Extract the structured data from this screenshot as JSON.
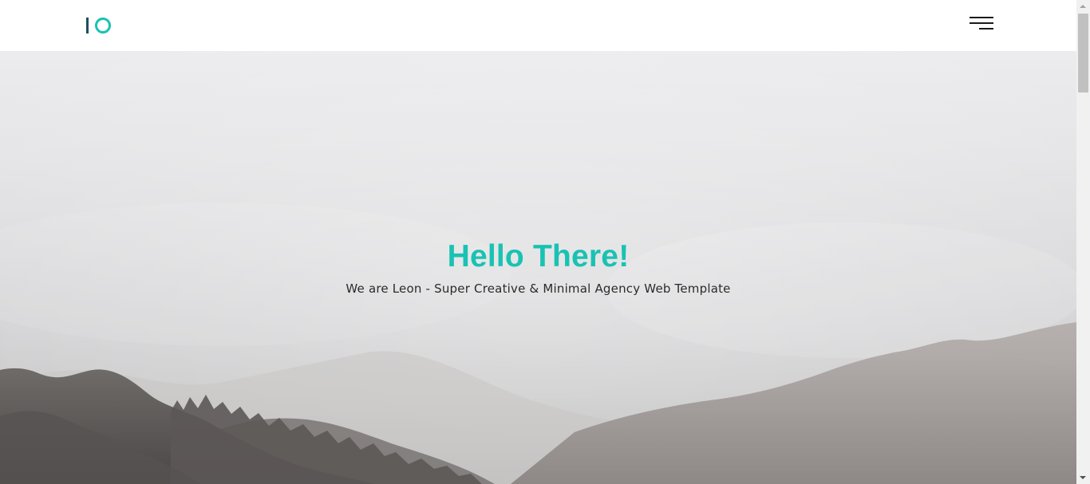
{
  "header": {
    "logo": {
      "icon": "io-logo-icon",
      "bar_color": "#1e4f5f",
      "ring_color": "#19c2b3"
    },
    "menu": {
      "icon": "hamburger-menu-icon"
    }
  },
  "hero": {
    "title": "Hello There!",
    "subtitle": "We are Leon - Super Creative & Minimal Agency Web Template",
    "background": "misty mountain landscape",
    "accent_color": "#19c2b3",
    "text_color": "#2b2b2b"
  },
  "scrollbar": {
    "track_color": "#f1f1f1",
    "thumb_color": "#c1c1c1"
  }
}
